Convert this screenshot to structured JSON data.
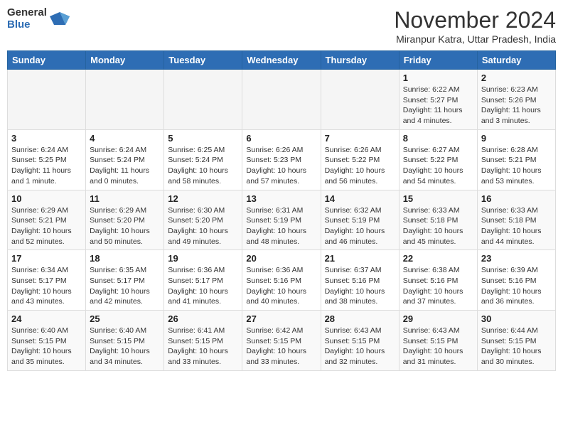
{
  "header": {
    "logo_general": "General",
    "logo_blue": "Blue",
    "month_title": "November 2024",
    "location": "Miranpur Katra, Uttar Pradesh, India"
  },
  "days_of_week": [
    "Sunday",
    "Monday",
    "Tuesday",
    "Wednesday",
    "Thursday",
    "Friday",
    "Saturday"
  ],
  "weeks": [
    [
      {
        "day": "",
        "info": ""
      },
      {
        "day": "",
        "info": ""
      },
      {
        "day": "",
        "info": ""
      },
      {
        "day": "",
        "info": ""
      },
      {
        "day": "",
        "info": ""
      },
      {
        "day": "1",
        "info": "Sunrise: 6:22 AM\nSunset: 5:27 PM\nDaylight: 11 hours\nand 4 minutes."
      },
      {
        "day": "2",
        "info": "Sunrise: 6:23 AM\nSunset: 5:26 PM\nDaylight: 11 hours\nand 3 minutes."
      }
    ],
    [
      {
        "day": "3",
        "info": "Sunrise: 6:24 AM\nSunset: 5:25 PM\nDaylight: 11 hours\nand 1 minute."
      },
      {
        "day": "4",
        "info": "Sunrise: 6:24 AM\nSunset: 5:24 PM\nDaylight: 11 hours\nand 0 minutes."
      },
      {
        "day": "5",
        "info": "Sunrise: 6:25 AM\nSunset: 5:24 PM\nDaylight: 10 hours\nand 58 minutes."
      },
      {
        "day": "6",
        "info": "Sunrise: 6:26 AM\nSunset: 5:23 PM\nDaylight: 10 hours\nand 57 minutes."
      },
      {
        "day": "7",
        "info": "Sunrise: 6:26 AM\nSunset: 5:22 PM\nDaylight: 10 hours\nand 56 minutes."
      },
      {
        "day": "8",
        "info": "Sunrise: 6:27 AM\nSunset: 5:22 PM\nDaylight: 10 hours\nand 54 minutes."
      },
      {
        "day": "9",
        "info": "Sunrise: 6:28 AM\nSunset: 5:21 PM\nDaylight: 10 hours\nand 53 minutes."
      }
    ],
    [
      {
        "day": "10",
        "info": "Sunrise: 6:29 AM\nSunset: 5:21 PM\nDaylight: 10 hours\nand 52 minutes."
      },
      {
        "day": "11",
        "info": "Sunrise: 6:29 AM\nSunset: 5:20 PM\nDaylight: 10 hours\nand 50 minutes."
      },
      {
        "day": "12",
        "info": "Sunrise: 6:30 AM\nSunset: 5:20 PM\nDaylight: 10 hours\nand 49 minutes."
      },
      {
        "day": "13",
        "info": "Sunrise: 6:31 AM\nSunset: 5:19 PM\nDaylight: 10 hours\nand 48 minutes."
      },
      {
        "day": "14",
        "info": "Sunrise: 6:32 AM\nSunset: 5:19 PM\nDaylight: 10 hours\nand 46 minutes."
      },
      {
        "day": "15",
        "info": "Sunrise: 6:33 AM\nSunset: 5:18 PM\nDaylight: 10 hours\nand 45 minutes."
      },
      {
        "day": "16",
        "info": "Sunrise: 6:33 AM\nSunset: 5:18 PM\nDaylight: 10 hours\nand 44 minutes."
      }
    ],
    [
      {
        "day": "17",
        "info": "Sunrise: 6:34 AM\nSunset: 5:17 PM\nDaylight: 10 hours\nand 43 minutes."
      },
      {
        "day": "18",
        "info": "Sunrise: 6:35 AM\nSunset: 5:17 PM\nDaylight: 10 hours\nand 42 minutes."
      },
      {
        "day": "19",
        "info": "Sunrise: 6:36 AM\nSunset: 5:17 PM\nDaylight: 10 hours\nand 41 minutes."
      },
      {
        "day": "20",
        "info": "Sunrise: 6:36 AM\nSunset: 5:16 PM\nDaylight: 10 hours\nand 40 minutes."
      },
      {
        "day": "21",
        "info": "Sunrise: 6:37 AM\nSunset: 5:16 PM\nDaylight: 10 hours\nand 38 minutes."
      },
      {
        "day": "22",
        "info": "Sunrise: 6:38 AM\nSunset: 5:16 PM\nDaylight: 10 hours\nand 37 minutes."
      },
      {
        "day": "23",
        "info": "Sunrise: 6:39 AM\nSunset: 5:16 PM\nDaylight: 10 hours\nand 36 minutes."
      }
    ],
    [
      {
        "day": "24",
        "info": "Sunrise: 6:40 AM\nSunset: 5:15 PM\nDaylight: 10 hours\nand 35 minutes."
      },
      {
        "day": "25",
        "info": "Sunrise: 6:40 AM\nSunset: 5:15 PM\nDaylight: 10 hours\nand 34 minutes."
      },
      {
        "day": "26",
        "info": "Sunrise: 6:41 AM\nSunset: 5:15 PM\nDaylight: 10 hours\nand 33 minutes."
      },
      {
        "day": "27",
        "info": "Sunrise: 6:42 AM\nSunset: 5:15 PM\nDaylight: 10 hours\nand 33 minutes."
      },
      {
        "day": "28",
        "info": "Sunrise: 6:43 AM\nSunset: 5:15 PM\nDaylight: 10 hours\nand 32 minutes."
      },
      {
        "day": "29",
        "info": "Sunrise: 6:43 AM\nSunset: 5:15 PM\nDaylight: 10 hours\nand 31 minutes."
      },
      {
        "day": "30",
        "info": "Sunrise: 6:44 AM\nSunset: 5:15 PM\nDaylight: 10 hours\nand 30 minutes."
      }
    ]
  ]
}
